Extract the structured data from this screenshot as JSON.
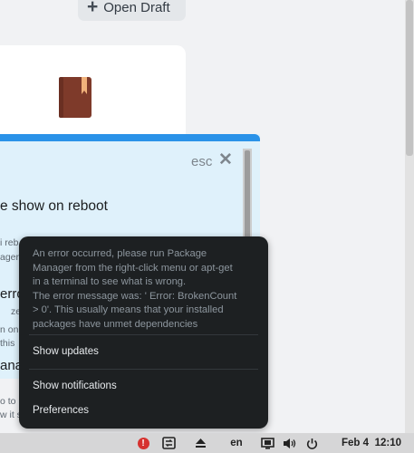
{
  "toolbar": {
    "open_draft_label": "Open Draft"
  },
  "dialog": {
    "esc_label": "esc",
    "heading": "e show on reboot",
    "fragments": [
      "i reb",
      "ager,",
      "erro",
      "ze",
      "n on",
      "this",
      "ana",
      "o to",
      "w it s"
    ]
  },
  "menu": {
    "error_message": "An error occurred, please run Package Manager from the right-click menu or apt-get in a terminal to see what is wrong.\nThe error message was: ' Error: BrokenCount > 0'. This usually means that your installed packages have unmet dependencies",
    "items": [
      {
        "label": "Show updates"
      },
      {
        "label": "Show notifications"
      },
      {
        "label": "Preferences"
      }
    ]
  },
  "panel": {
    "language": "en",
    "date": "Feb 4",
    "time": "12:10"
  },
  "colors": {
    "dialog_accent": "#2a92e8",
    "alert_red": "#d6322f",
    "menu_bg": "#1d2022"
  }
}
